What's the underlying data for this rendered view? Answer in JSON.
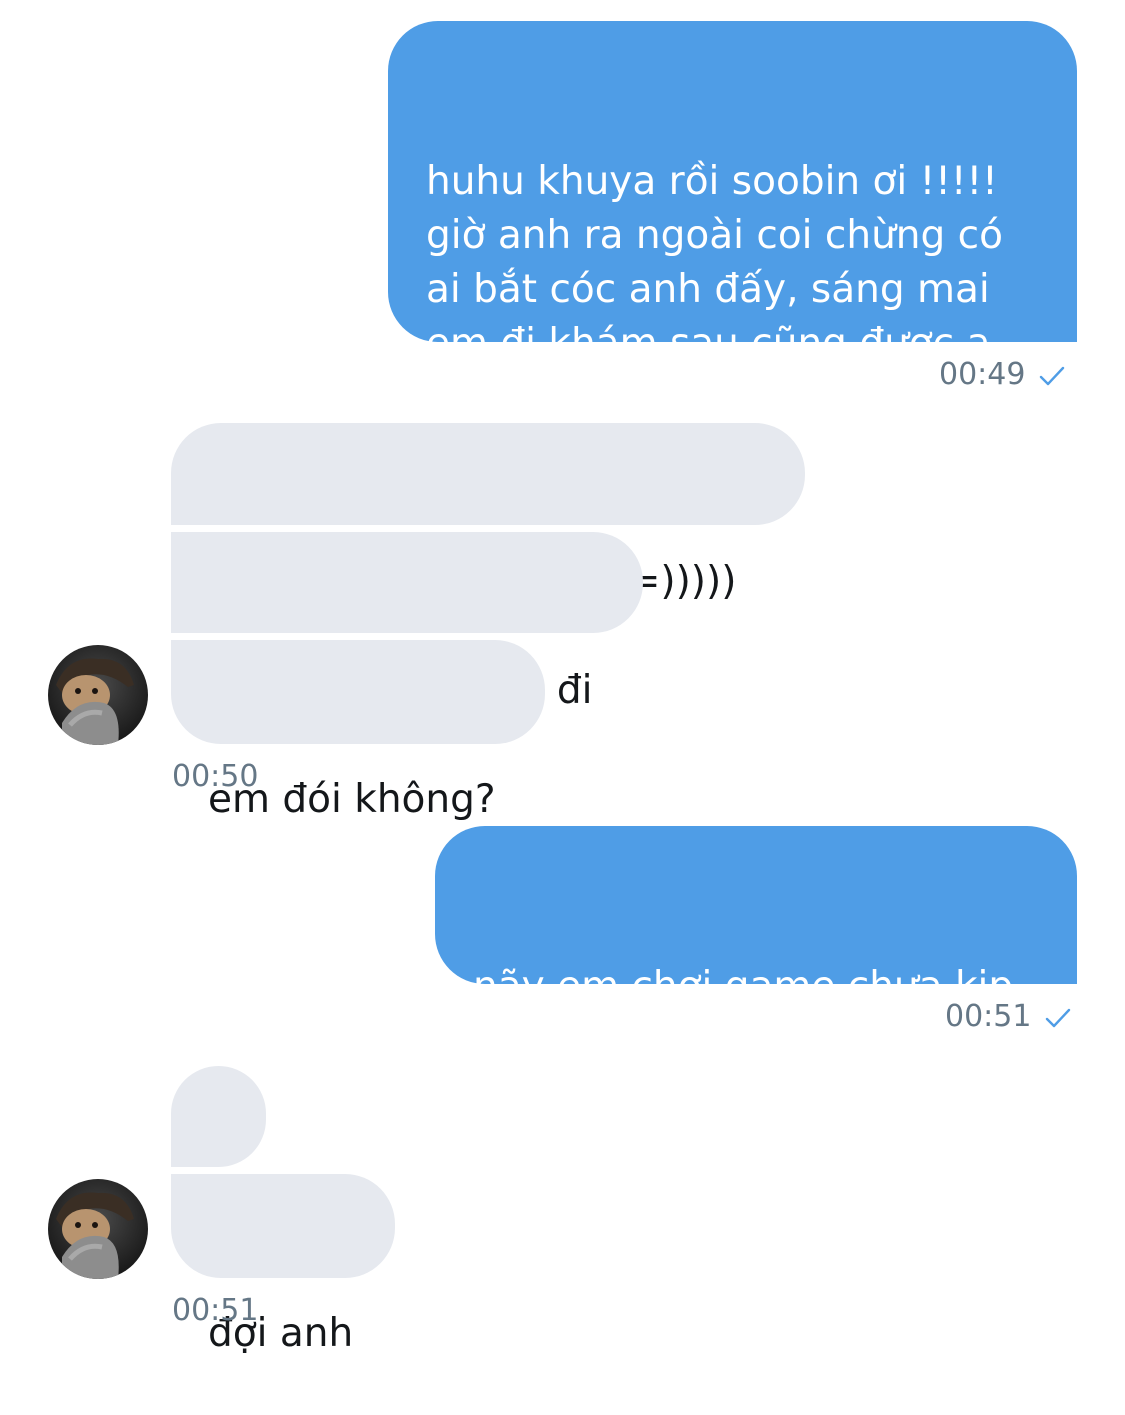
{
  "conversation": {
    "messages": [
      {
        "from": "me",
        "text": "huhu khuya rồi soobin ơi !!!!!\ngiờ anh ra ngoài coi chừng có\nai bắt cóc anh đấy, sáng mai\nem đi khám sau cũng được ạ\nㅠㅠ",
        "time": "00:49"
      },
      {
        "from": "them",
        "text": "có em bị bắt cóc đấy =)))))"
      },
      {
        "from": "them",
        "text": "ngồi yên chờ anh đi"
      },
      {
        "from": "them",
        "text": "em đói không?",
        "time": "00:50"
      },
      {
        "from": "me",
        "text": "nãy em chơi game chưa kịp\năn tối..",
        "time": "00:51"
      },
      {
        "from": "them",
        "text": "?"
      },
      {
        "from": "them",
        "text": "đợi anh",
        "time": "00:51"
      }
    ]
  },
  "colors": {
    "outgoing_bubble": "#4f9de6",
    "incoming_bubble": "#e6e9ef",
    "timestamp": "#657786",
    "read_check": "#4f9de6"
  },
  "icons": {
    "read_receipt": "checkmark-icon",
    "avatar": "user-avatar"
  }
}
